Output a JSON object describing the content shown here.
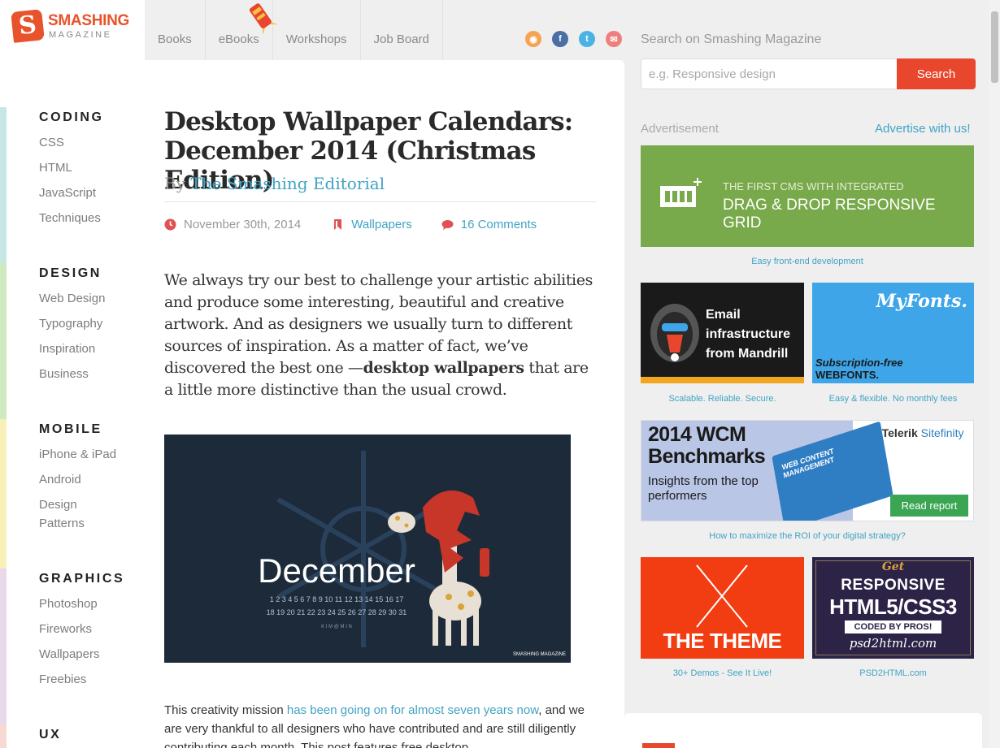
{
  "logo": {
    "mark": "S",
    "name": "SMASHING",
    "sub": "MAGAZINE"
  },
  "nav": [
    "Books",
    "eBooks",
    "Workshops",
    "Job Board"
  ],
  "social": [
    {
      "name": "rss-icon",
      "glyph": "◉",
      "color": "#f6a355"
    },
    {
      "name": "facebook-icon",
      "glyph": "f",
      "color": "#4a6fa5"
    },
    {
      "name": "twitter-icon",
      "glyph": "t",
      "color": "#4ab3e3"
    },
    {
      "name": "newsletter-icon",
      "glyph": "✉",
      "color": "#ee7f7f"
    }
  ],
  "search": {
    "label": "Search on Smashing Magazine",
    "placeholder": "e.g. Responsive design",
    "button": "Search"
  },
  "categories": [
    {
      "title": "CODING",
      "color": "#c5e8e4",
      "links": [
        "CSS",
        "HTML",
        "JavaScript",
        "Techniques"
      ]
    },
    {
      "title": "DESIGN",
      "color": "#cdeac0",
      "links": [
        "Web Design",
        "Typography",
        "Inspiration",
        "Business"
      ]
    },
    {
      "title": "MOBILE",
      "color": "#f7f1b7",
      "links": [
        "iPhone & iPad",
        "Android",
        "Design Patterns"
      ]
    },
    {
      "title": "GRAPHICS",
      "color": "#e7d8ea",
      "links": [
        "Photoshop",
        "Fireworks",
        "Wallpapers",
        "Freebies"
      ]
    },
    {
      "title": "UX",
      "color": "#f7d9d3",
      "links": []
    }
  ],
  "article": {
    "title": "Desktop Wallpaper Calendars: December 2014 (Christmas Edition)",
    "by": "By",
    "author": "The Smashing Editorial",
    "date": "November 30th, 2014",
    "category": "Wallpapers",
    "comments": "16 Comments",
    "lead_1": "We always try our best to challenge your artistic abilities and produce some interesting, beautiful and creative artwork. And as designers we usually turn to different sources of inspiration. As a matter of fact, we’ve discovered the best one —",
    "lead_bold": "desktop wallpapers",
    "lead_2": " that are a little more distinctive than the usual crowd.",
    "hero": {
      "month": "December",
      "row1": "1 2 3 4 5 6 7 8 9 10 11 12 13 14 15 16 17",
      "row2": "18 19 20 21 22 23 24 25 26 27 28 29 30 31",
      "credit": "K I M @ M I N",
      "brand": "SMASHING MAGAZINE"
    },
    "body_1": "This creativity mission ",
    "body_link": "has been going on for almost seven years now",
    "body_2": ", and we are very thankful to all designers who have contributed and are still diligently contributing each month. This post features free desktop"
  },
  "ads": {
    "label": "Advertisement",
    "link": "Advertise with us!",
    "cms": {
      "line1": "THE FIRST CMS WITH INTEGRATED",
      "line2": "DRAG & DROP RESPONSIVE GRID",
      "caption": "Easy front-end development"
    },
    "mandrill": {
      "text": "Email infrastructure from Mandrill",
      "caption": "Scalable. Reliable. Secure."
    },
    "myfonts": {
      "logo": "MyFonts.",
      "line1": "Subscription-free",
      "line2": "WEBFONTS.",
      "caption": "Easy & flexible. No monthly fees"
    },
    "telerik": {
      "title": "2014 WCM Benchmarks",
      "sub": "Insights from the top performers",
      "brand_a": "Telerik",
      "brand_b": "Sitefinity",
      "book": "WEB CONTENT MANAGEMENT",
      "button": "Read report",
      "caption": "How to maximize the ROI of your digital strategy?"
    },
    "theme": {
      "text": "THE THEME",
      "caption": "30+ Demos - See It Live!"
    },
    "psd": {
      "get": "Get",
      "line1": "RESPONSIVE",
      "line2": "HTML5/CSS3",
      "line3": "CODED BY PROS!",
      "line4": "psd2html.com",
      "caption": "PSD2HTML.com"
    }
  },
  "colors": {
    "accent": "#e8472d",
    "link": "#41a3c4",
    "cms_green": "#78a94a",
    "myfonts_blue": "#3ea5e8",
    "theme_red": "#f23d12",
    "psd_purple": "#2d2347"
  }
}
